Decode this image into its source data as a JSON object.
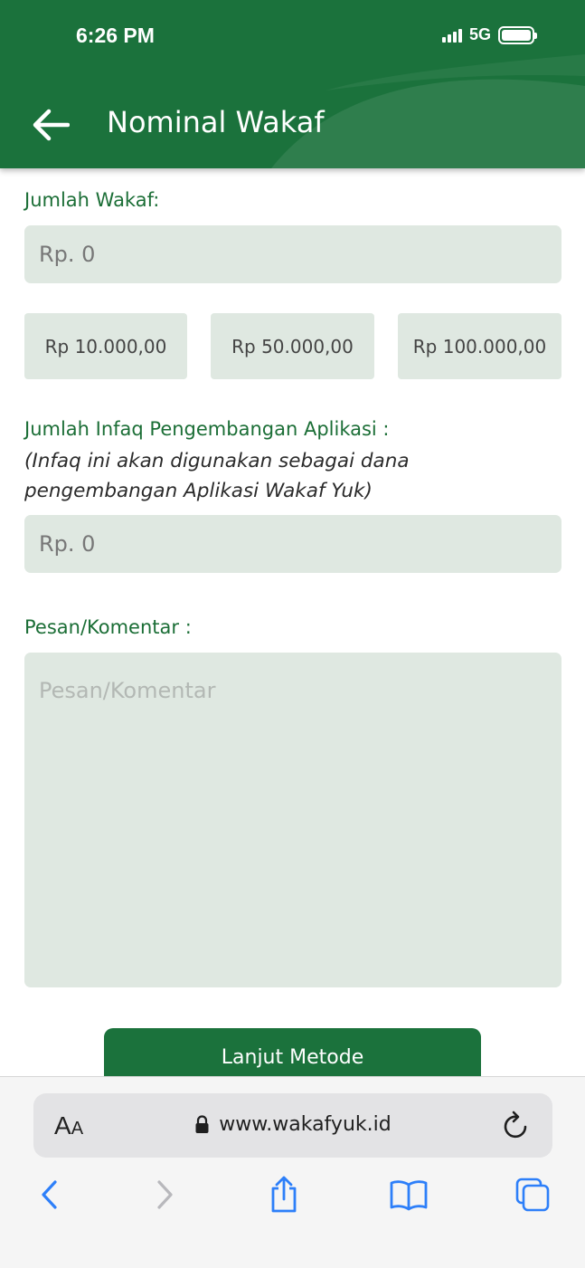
{
  "status_bar": {
    "time": "6:26 PM",
    "network": "5G"
  },
  "header": {
    "title": "Nominal Wakaf",
    "back_icon": "arrow-left-icon",
    "color": "#1b723c"
  },
  "form": {
    "wakaf_label": "Jumlah Wakaf:",
    "wakaf_value": "Rp. 0",
    "quick_amounts": [
      "Rp 10.000,00",
      "Rp 50.000,00",
      "Rp 100.000,00"
    ],
    "infaq_label": "Jumlah Infaq Pengembangan Aplikasi :",
    "infaq_note_line1": "(Infaq ini akan digunakan sebagai dana",
    "infaq_note_line2": "pengembangan Aplikasi Wakaf Yuk)",
    "infaq_value": "Rp. 0",
    "comment_label": "Pesan/Komentar :",
    "comment_placeholder": "Pesan/Komentar",
    "field_color": "#dfe8e1",
    "label_color": "#1b6e36"
  },
  "cta": {
    "label": "Lanjut Metode"
  },
  "browser": {
    "text_size_big": "A",
    "text_size_small": "A",
    "url": "www.wakafyuk.id",
    "icons": [
      "lock-icon",
      "reload-icon",
      "back-chevron-icon",
      "forward-chevron-icon",
      "share-icon",
      "bookmarks-icon",
      "tabs-icon"
    ],
    "accent": "#2d7ff9"
  }
}
